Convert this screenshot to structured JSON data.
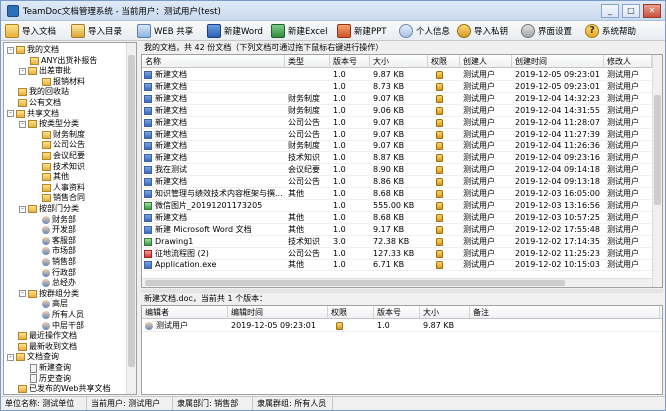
{
  "window": {
    "title": "TeamDoc文档管理系统 - 当前用户：测试用户(test)"
  },
  "toolbar": [
    {
      "label": "导入文档",
      "icon": "folder-import-icon"
    },
    {
      "label": "导入目录",
      "icon": "folder-tree-icon"
    },
    {
      "label": "WEB 共享",
      "icon": "web-share-icon"
    },
    {
      "label": "新建Word",
      "icon": "word-doc-icon"
    },
    {
      "label": "新建Excel",
      "icon": "excel-doc-icon"
    },
    {
      "label": "新建PPT",
      "icon": "ppt-doc-icon"
    },
    {
      "label": "个人信息",
      "icon": "user-info-icon"
    },
    {
      "label": "导入私钥",
      "icon": "key-icon"
    },
    {
      "label": "界面设置",
      "icon": "gear-icon"
    },
    {
      "label": "系统帮助",
      "icon": "help-icon"
    }
  ],
  "tree": [
    {
      "label": "我的文档",
      "level": 0,
      "toggle": "-",
      "icon": "folder"
    },
    {
      "label": "ANY出货补报告",
      "level": 1,
      "toggle": "",
      "icon": "folder"
    },
    {
      "label": "出差审批",
      "level": 1,
      "toggle": "-",
      "icon": "folder"
    },
    {
      "label": "报销材料",
      "level": 2,
      "toggle": "",
      "icon": "folder"
    },
    {
      "label": "我的回收站",
      "level": 0,
      "toggle": "",
      "icon": "folder"
    },
    {
      "label": "公有文档",
      "level": 0,
      "toggle": "",
      "icon": "folder"
    },
    {
      "label": "共享文档",
      "level": 0,
      "toggle": "-",
      "icon": "folder"
    },
    {
      "label": "按类型分类",
      "level": 1,
      "toggle": "-",
      "icon": "folder"
    },
    {
      "label": "财务制度",
      "level": 2,
      "toggle": "",
      "icon": "folder"
    },
    {
      "label": "公司公告",
      "level": 2,
      "toggle": "",
      "icon": "folder"
    },
    {
      "label": "会议纪要",
      "level": 2,
      "toggle": "",
      "icon": "folder"
    },
    {
      "label": "技术知识",
      "level": 2,
      "toggle": "",
      "icon": "folder"
    },
    {
      "label": "其他",
      "level": 2,
      "toggle": "",
      "icon": "folder"
    },
    {
      "label": "人事资料",
      "level": 2,
      "toggle": "",
      "icon": "folder"
    },
    {
      "label": "销售合同",
      "level": 2,
      "toggle": "",
      "icon": "folder"
    },
    {
      "label": "按部门分类",
      "level": 1,
      "toggle": "-",
      "icon": "folder"
    },
    {
      "label": "财务部",
      "level": 2,
      "toggle": "",
      "icon": "person"
    },
    {
      "label": "开发部",
      "level": 2,
      "toggle": "",
      "icon": "person"
    },
    {
      "label": "客服部",
      "level": 2,
      "toggle": "",
      "icon": "person"
    },
    {
      "label": "市场部",
      "level": 2,
      "toggle": "",
      "icon": "person"
    },
    {
      "label": "销售部",
      "level": 2,
      "toggle": "",
      "icon": "person"
    },
    {
      "label": "行政部",
      "level": 2,
      "toggle": "",
      "icon": "person"
    },
    {
      "label": "总经办",
      "level": 2,
      "toggle": "",
      "icon": "person"
    },
    {
      "label": "按群组分类",
      "level": 1,
      "toggle": "-",
      "icon": "folder"
    },
    {
      "label": "高层",
      "level": 2,
      "toggle": "",
      "icon": "person"
    },
    {
      "label": "所有人员",
      "level": 2,
      "toggle": "",
      "icon": "person"
    },
    {
      "label": "中层干部",
      "level": 2,
      "toggle": "",
      "icon": "person"
    },
    {
      "label": "最近操作文档",
      "level": 0,
      "toggle": "",
      "icon": "folder"
    },
    {
      "label": "最新收到文档",
      "level": 0,
      "toggle": "",
      "icon": "folder"
    },
    {
      "label": "文档查询",
      "level": 0,
      "toggle": "-",
      "icon": "folder"
    },
    {
      "label": "新建查询",
      "level": 1,
      "toggle": "",
      "icon": "doc"
    },
    {
      "label": "历史查询",
      "level": 1,
      "toggle": "",
      "icon": "doc"
    },
    {
      "label": "已发布的Web共享文档",
      "level": 0,
      "toggle": "",
      "icon": "folder"
    }
  ],
  "doclist": {
    "header": "我的文档，共 42 份文档（下列文档可通过拖下鼠标右键进行操作）",
    "columns": [
      "名称",
      "类型",
      "版本号",
      "大小",
      "权限",
      "创建人",
      "创建时间",
      "修改人"
    ],
    "rows": [
      {
        "name": "新建文档",
        "type": "",
        "version": "1.0",
        "size": "9.87 KB",
        "creator": "测试用户",
        "created": "2019-12-05 09:23:01",
        "modifier": "测试用户",
        "icon": "doc"
      },
      {
        "name": "新建文档",
        "type": "",
        "version": "1.0",
        "size": "8.73 KB",
        "creator": "测试用户",
        "created": "2019-12-05 09:23:01",
        "modifier": "测试用户",
        "icon": "doc"
      },
      {
        "name": "新建文档",
        "type": "财务制度",
        "version": "1.0",
        "size": "9.07 KB",
        "creator": "测试用户",
        "created": "2019-12-04 14:32:23",
        "modifier": "测试用户",
        "icon": "doc"
      },
      {
        "name": "新建文档",
        "type": "财务制度",
        "version": "1.0",
        "size": "9.06 KB",
        "creator": "测试用户",
        "created": "2019-12-04 14:31:55",
        "modifier": "测试用户",
        "icon": "doc"
      },
      {
        "name": "新建文档",
        "type": "公司公告",
        "version": "1.0",
        "size": "9.07 KB",
        "creator": "测试用户",
        "created": "2019-12-04 11:28:07",
        "modifier": "测试用户",
        "icon": "doc"
      },
      {
        "name": "新建文档",
        "type": "公司公告",
        "version": "1.0",
        "size": "9.07 KB",
        "creator": "测试用户",
        "created": "2019-12-04 11:27:39",
        "modifier": "测试用户",
        "icon": "doc"
      },
      {
        "name": "新建文档",
        "type": "财务制度",
        "version": "1.0",
        "size": "9.07 KB",
        "creator": "测试用户",
        "created": "2019-12-04 11:26:36",
        "modifier": "测试用户",
        "icon": "doc"
      },
      {
        "name": "新建文档",
        "type": "技术知识",
        "version": "1.0",
        "size": "8.87 KB",
        "creator": "测试用户",
        "created": "2019-12-04 09:23:16",
        "modifier": "测试用户",
        "icon": "doc"
      },
      {
        "name": "我在测试",
        "type": "会议纪要",
        "version": "1.0",
        "size": "8.90 KB",
        "creator": "测试用户",
        "created": "2019-12-04 09:14:18",
        "modifier": "测试用户",
        "icon": "doc"
      },
      {
        "name": "新建文档",
        "type": "公司公告",
        "version": "1.0",
        "size": "8.86 KB",
        "creator": "测试用户",
        "created": "2019-12-04 09:13:18",
        "modifier": "测试用户",
        "icon": "doc"
      },
      {
        "name": "知识管理与绩效技术内容框架与撰...",
        "type": "其他",
        "version": "1.0",
        "size": "8.68 KB",
        "creator": "测试用户",
        "created": "2019-12-03 16:05:00",
        "modifier": "测试用户",
        "icon": "doc"
      },
      {
        "name": "微信图片_20191201173205",
        "type": "",
        "version": "1.0",
        "size": "555.00 KB",
        "creator": "测试用户",
        "created": "2019-12-03 13:16:56",
        "modifier": "测试用户",
        "icon": "img"
      },
      {
        "name": "新建文档",
        "type": "其他",
        "version": "1.0",
        "size": "8.68 KB",
        "creator": "测试用户",
        "created": "2019-12-03 10:57:25",
        "modifier": "测试用户",
        "icon": "doc"
      },
      {
        "name": "新建 Microsoft Word 文档",
        "type": "其他",
        "version": "1.0",
        "size": "9.17 KB",
        "creator": "测试用户",
        "created": "2019-12-02 17:55:48",
        "modifier": "测试用户",
        "icon": "doc"
      },
      {
        "name": "Drawing1",
        "type": "技术知识",
        "version": "3.0",
        "size": "72.38 KB",
        "creator": "测试用户",
        "created": "2019-12-02 17:14:35",
        "modifier": "测试用户",
        "icon": "img"
      },
      {
        "name": "征地流程图 (2)",
        "type": "公司公告",
        "version": "1.0",
        "size": "127.33 KB",
        "creator": "测试用户",
        "created": "2019-12-02 11:25:23",
        "modifier": "测试用户",
        "icon": "pdf"
      },
      {
        "name": "Application.exe",
        "type": "其他",
        "version": "1.0",
        "size": "6.71 KB",
        "creator": "测试用户",
        "created": "2019-12-02 10:15:03",
        "modifier": "测试用户",
        "icon": "doc"
      }
    ]
  },
  "versions": {
    "header": "新建文档.doc，当前共 1 个版本：",
    "columns": [
      "编辑者",
      "编辑时间",
      "权限",
      "版本号",
      "大小",
      "备注"
    ],
    "rows": [
      {
        "editor": "测试用户",
        "time": "2019-12-05 09:23:01",
        "version": "1.0",
        "size": "9.87 KB",
        "note": ""
      }
    ]
  },
  "status": {
    "unit": "单位名称: 测试单位",
    "user": "当前用户: 测试用户",
    "dept": "隶属部门: 销售部",
    "group": "隶属群组: 所有人员"
  }
}
